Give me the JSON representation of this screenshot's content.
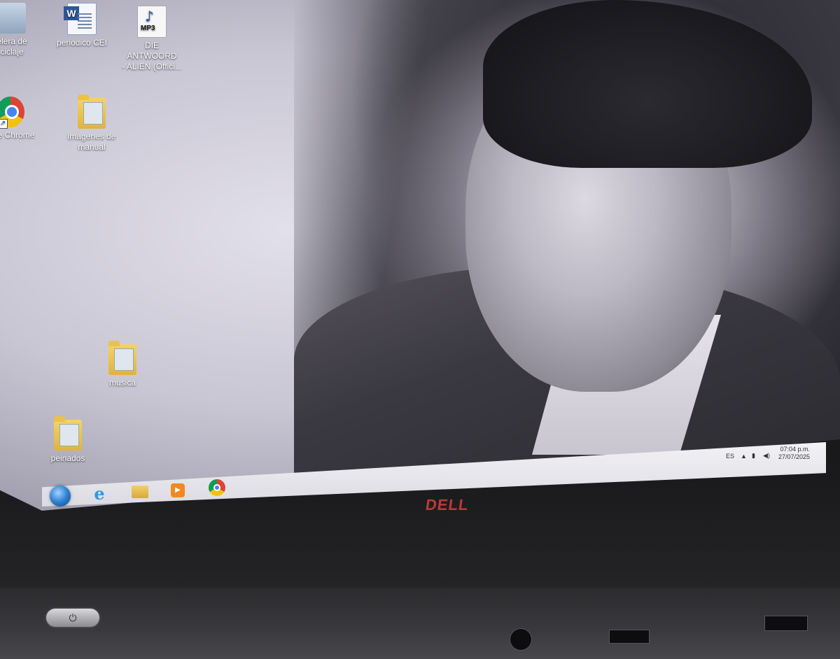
{
  "desktop": {
    "icons": [
      {
        "label": "elera de\nciclaje",
        "icon": "recycle-bin-icon"
      },
      {
        "label": "periodico CEI",
        "icon": "word-document-icon"
      },
      {
        "label": "DIE ANTWOORD\n- ALIEN (Offici...",
        "icon": "mp3-file-icon"
      },
      {
        "label": "ogle Chrome",
        "icon": "chrome-icon"
      },
      {
        "label": "imagenes de\nmanual",
        "icon": "folder-icon"
      },
      {
        "label": "musica",
        "icon": "folder-icon"
      },
      {
        "label": "peinados",
        "icon": "folder-icon"
      }
    ]
  },
  "taskbar": {
    "pinned": [
      {
        "name": "start",
        "icon": "windows-start-orb-icon"
      },
      {
        "name": "internet-explorer",
        "icon": "internet-explorer-icon",
        "glyph": "e"
      },
      {
        "name": "file-explorer",
        "icon": "folder-icon"
      },
      {
        "name": "media-player",
        "icon": "media-player-icon",
        "glyph": "▶"
      },
      {
        "name": "chrome",
        "icon": "chrome-icon"
      }
    ],
    "tray": {
      "language": "ES",
      "show_hidden_glyph": "▲",
      "time": "07:04 p.m.",
      "date": "27/07/2025"
    }
  },
  "hardware": {
    "brand": "DELL",
    "power_glyph": "⏻",
    "brand_color": "#b83a3a"
  }
}
